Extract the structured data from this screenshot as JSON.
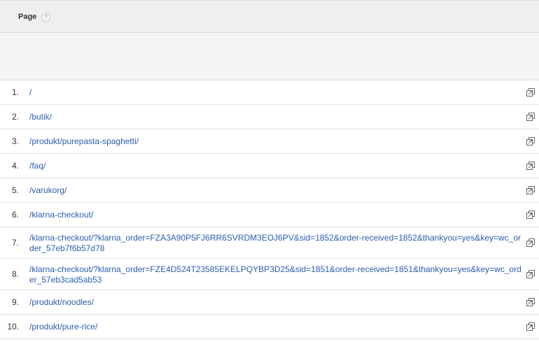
{
  "header": {
    "title": "Page",
    "help_glyph": "?"
  },
  "rows": [
    {
      "index": "1.",
      "page": "/"
    },
    {
      "index": "2.",
      "page": "/butik/"
    },
    {
      "index": "3.",
      "page": "/produkt/purepasta-spaghetti/"
    },
    {
      "index": "4.",
      "page": "/faq/"
    },
    {
      "index": "5.",
      "page": "/varukorg/"
    },
    {
      "index": "6.",
      "page": "/klarna-checkout/"
    },
    {
      "index": "7.",
      "page": "/klarna-checkout/?klarna_order=FZA3A90P5FJ6RR6SVRDM3EOJ6PV&sid=1852&order-received=1852&thankyou=yes&key=wc_order_57eb7f6b57d78"
    },
    {
      "index": "8.",
      "page": "/klarna-checkout/?klarna_order=FZE4D524T23585EKELPQYBP3D25&sid=1851&order-received=1851&thankyou=yes&key=wc_order_57eb3cad5ab53"
    },
    {
      "index": "9.",
      "page": "/produkt/noodles/"
    },
    {
      "index": "10.",
      "page": "/produkt/pure-rice/"
    }
  ],
  "icons": {
    "row_action": "open-in-new-window-icon"
  },
  "colors": {
    "link": "#2a5db0",
    "header_bg": "#efefef"
  }
}
